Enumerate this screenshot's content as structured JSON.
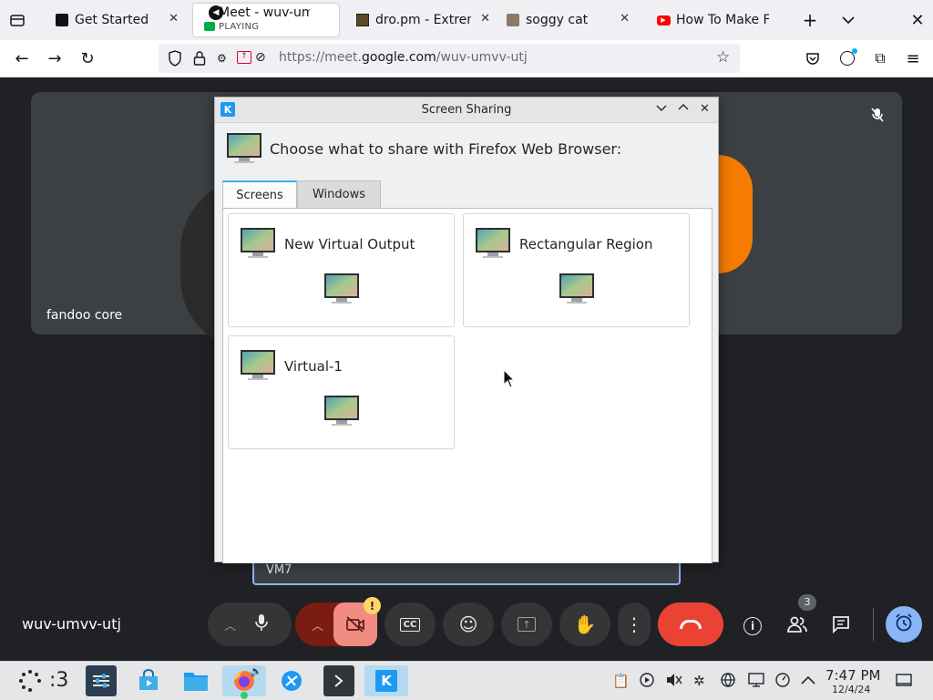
{
  "browser": {
    "tabs": [
      {
        "title": "Get Started",
        "sub": ""
      },
      {
        "title": "Meet - wuv-umvv-utj",
        "sub": "PLAYING"
      },
      {
        "title": "dro.pm - Extreme",
        "sub": ""
      },
      {
        "title": "soggy cat",
        "sub": ""
      },
      {
        "title": "How To Make F",
        "sub": ""
      }
    ],
    "url": {
      "prefix": "https://meet.",
      "domain": "google.com",
      "path": "/wuv-umvv-utj"
    }
  },
  "meet": {
    "participant_name": "fandoo core",
    "presenter_label": "VM7",
    "meeting_code": "wuv-umvv-utj",
    "people_count": "3",
    "accent_red": "#ea4335",
    "accent_blue": "#8ab4f8"
  },
  "dialog": {
    "title": "Screen Sharing",
    "heading": "Choose what to share with Firefox Web Browser:",
    "tabs": [
      "Screens",
      "Windows"
    ],
    "options": [
      "New Virtual Output",
      "Rectangular Region",
      "Virtual-1"
    ]
  },
  "taskbar": {
    "workspace": ":3",
    "time": "7:47 PM",
    "date": "12/4/24"
  }
}
